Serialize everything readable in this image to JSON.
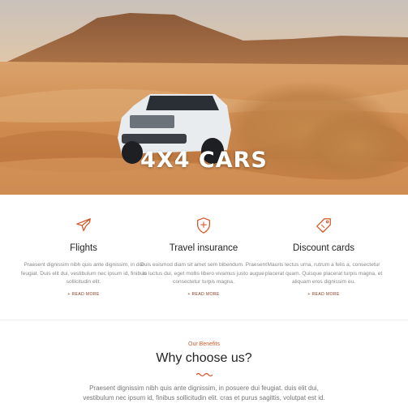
{
  "hero": {
    "title": "4X4 CARS"
  },
  "features": [
    {
      "title": "Flights",
      "icon": "airplane-icon",
      "description": "Praesent dignissim nibh quis ante dignissim, in dui feugiat. Duis elit dui, vestibulum nec ipsum id, finibus sollicitudin elit.",
      "more": "+ READ MORE"
    },
    {
      "title": "Travel insurance",
      "icon": "shield-icon",
      "description": "Duis euismod diam sit amet sem bibendum. Praesent in luctus dui, eget mollis libero vivamus justo augue consectetur turpis magna.",
      "more": "+ READ MORE"
    },
    {
      "title": "Discount cards",
      "icon": "discount-tag-icon",
      "description": "Mauris lectus urna, rutrum a felis a, consectetur placerat quam. Quisque placerat turpis magna, et aliquam eros dignissim eu.",
      "more": "+ READ MORE"
    }
  ],
  "benefits": {
    "eyebrow": "Our Benefits",
    "title": "Why choose us?",
    "text": "Praesent dignissim nibh quis ante dignissim, in posuere dui feugiat. duis elit dui, vestibulum nec ipsum id, finibus sollicitudin elit. cras et purus sagittis, volutpat est id."
  },
  "colors": {
    "accent": "#d45a2b",
    "link": "#8a3d22"
  }
}
